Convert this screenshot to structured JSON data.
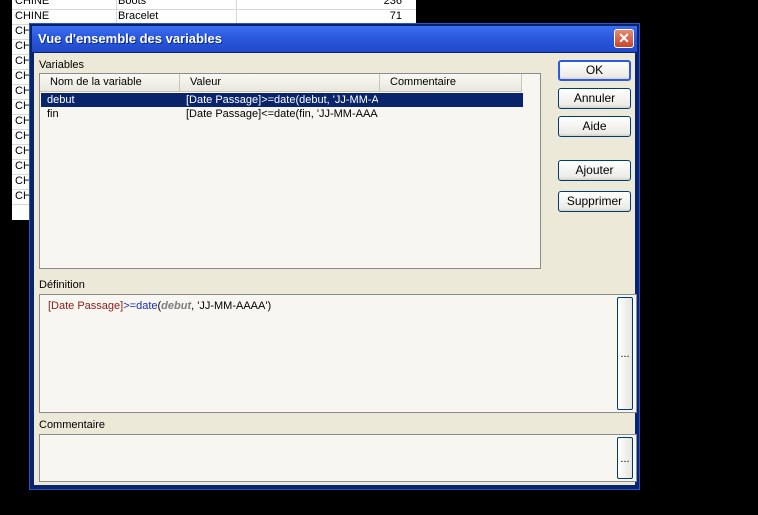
{
  "background": {
    "rows": [
      {
        "c1": "CHINE",
        "c2": "Boots",
        "c3": "236"
      },
      {
        "c1": "CHINE",
        "c2": "Bracelet",
        "c3": "71"
      },
      {
        "c1": "CH",
        "c2": "",
        "c3": ""
      },
      {
        "c1": "CH",
        "c2": "",
        "c3": ""
      },
      {
        "c1": "CH",
        "c2": "",
        "c3": ""
      },
      {
        "c1": "CH",
        "c2": "",
        "c3": ""
      },
      {
        "c1": "CH",
        "c2": "",
        "c3": ""
      },
      {
        "c1": "CH",
        "c2": "",
        "c3": ""
      },
      {
        "c1": "CH",
        "c2": "",
        "c3": ""
      },
      {
        "c1": "CH",
        "c2": "",
        "c3": ""
      },
      {
        "c1": "CH",
        "c2": "",
        "c3": ""
      },
      {
        "c1": "CH",
        "c2": "",
        "c3": ""
      },
      {
        "c1": "CH",
        "c2": "",
        "c3": ""
      },
      {
        "c1": "CH",
        "c2": "",
        "c3": ""
      }
    ]
  },
  "dialog": {
    "title": "Vue d'ensemble des variables",
    "close_label": "✕",
    "variables_label": "Variables",
    "columns": [
      "Nom de la variable",
      "Valeur",
      "Commentaire"
    ],
    "variables": [
      {
        "name": "debut",
        "value": "[Date Passage]>=date(debut, 'JJ-MM-AAAA')",
        "comment": ""
      },
      {
        "name": "fin",
        "value": "[Date Passage]<=date(fin, 'JJ-MM-AAAA')",
        "comment": ""
      }
    ],
    "buttons": {
      "ok": "OK",
      "cancel": "Annuler",
      "help": "Aide",
      "add": "Ajouter",
      "delete": "Supprimer"
    },
    "definition_label": "Définition",
    "definition": {
      "field": "[Date Passage]",
      "op": ">=",
      "func": "date",
      "open": "(",
      "var": "debut",
      "sep": ", ",
      "str": "'JJ-MM-AAAA'",
      "close": ")"
    },
    "ellipsis": "...",
    "comment_label": "Commentaire",
    "comment_value": ""
  }
}
